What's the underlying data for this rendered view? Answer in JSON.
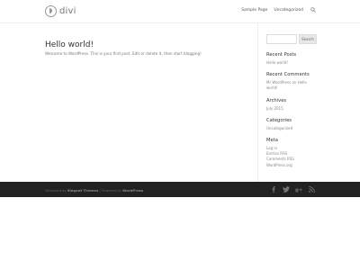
{
  "header": {
    "logo_text": "divi",
    "nav": [
      {
        "label": "Sample Page"
      },
      {
        "label": "Uncategorized"
      }
    ]
  },
  "post": {
    "title": "Hello world!",
    "excerpt": "Welcome to WordPress. This is your first post. Edit or delete it, then start blogging!"
  },
  "sidebar": {
    "search_button": "Search",
    "recent_posts": {
      "title": "Recent Posts",
      "items": [
        "Hello world!"
      ]
    },
    "recent_comments": {
      "title": "Recent Comments",
      "items": [
        "Mr WordPress on Hello world!"
      ]
    },
    "archives": {
      "title": "Archives",
      "items": [
        "July 2015"
      ]
    },
    "categories": {
      "title": "Categories",
      "items": [
        "Uncategorized"
      ]
    },
    "meta": {
      "title": "Meta",
      "items": [
        "Log in",
        "Entries RSS",
        "Comments RSS",
        "WordPress.org"
      ]
    }
  },
  "footer": {
    "designed_by": "Designed by",
    "designer": "Elegant Themes",
    "separator": "|",
    "powered_by": "Powered by",
    "platform": "WordPress",
    "social_icons": [
      "facebook-icon",
      "twitter-icon",
      "google-plus-icon",
      "rss-icon"
    ]
  },
  "colors": {
    "footer_bg": "#222222",
    "text": "#666666",
    "title": "#333333"
  }
}
